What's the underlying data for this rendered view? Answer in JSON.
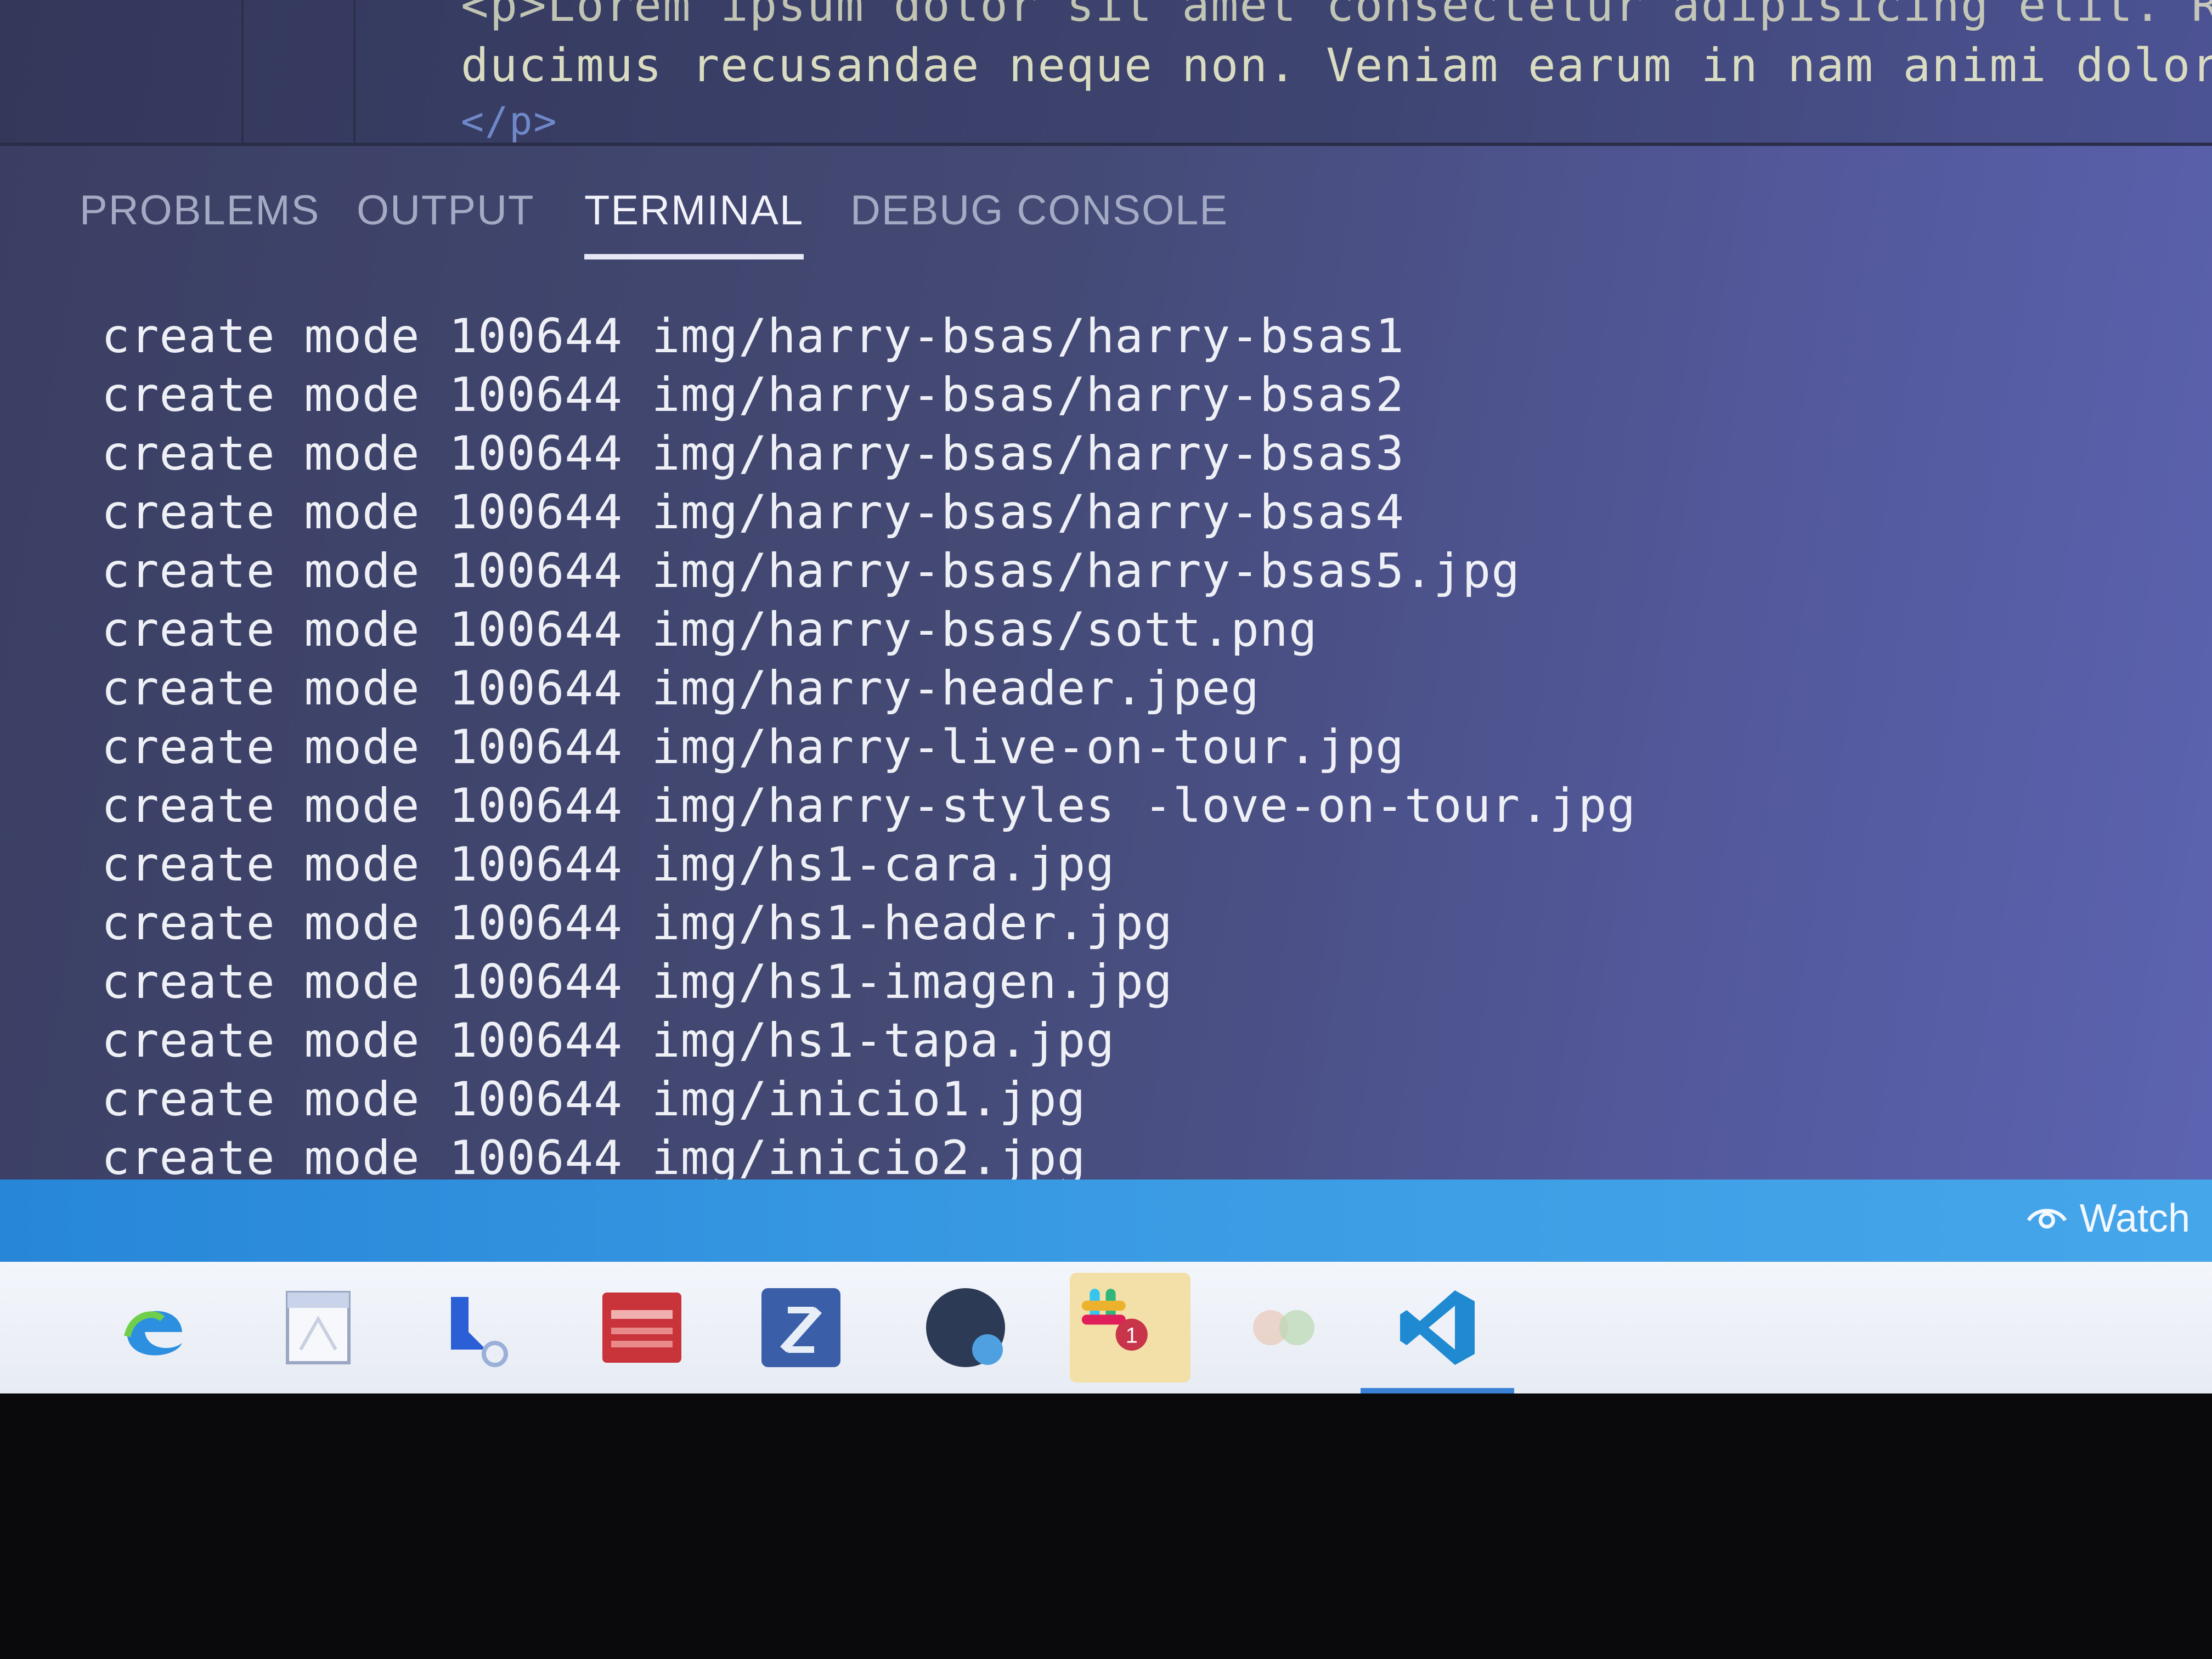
{
  "editor": {
    "lines": [
      "<p>Lorem ipsum dolor sit amet consectetur adipisicing elit. Repell",
      "ducimus recusandae neque non. Veniam earum in nam animi dolores la",
      "</p>"
    ]
  },
  "panel": {
    "tabs": [
      {
        "label": "PROBLEMS",
        "active": false
      },
      {
        "label": "OUTPUT",
        "active": false
      },
      {
        "label": "TERMINAL",
        "active": true
      },
      {
        "label": "DEBUG CONSOLE",
        "active": false
      }
    ]
  },
  "terminal": {
    "lines": [
      "create mode 100644 img/harry-bsas/harry-bsas1",
      "create mode 100644 img/harry-bsas/harry-bsas2",
      "create mode 100644 img/harry-bsas/harry-bsas3",
      "create mode 100644 img/harry-bsas/harry-bsas4",
      "create mode 100644 img/harry-bsas/harry-bsas5.jpg",
      "create mode 100644 img/harry-bsas/sott.png",
      "create mode 100644 img/harry-header.jpeg",
      "create mode 100644 img/harry-live-on-tour.jpg",
      "create mode 100644 img/harry-styles -love-on-tour.jpg",
      "create mode 100644 img/hs1-cara.jpg",
      "create mode 100644 img/hs1-header.jpg",
      "create mode 100644 img/hs1-imagen.jpg",
      "create mode 100644 img/hs1-tapa.jpg",
      "create mode 100644 img/inicio1.jpg",
      "create mode 100644 img/inicio2.jpg"
    ]
  },
  "statusbar": {
    "watch_label": "Watch",
    "watch_icon": "eye-icon"
  },
  "taskbar": {
    "items": [
      {
        "icon": "edge-icon"
      },
      {
        "icon": "document-icon"
      },
      {
        "icon": "app-icon"
      },
      {
        "icon": "app-icon"
      },
      {
        "icon": "app-icon"
      },
      {
        "icon": "app-icon"
      },
      {
        "icon": "slack-icon",
        "badge": "1"
      },
      {
        "icon": "app-icon"
      },
      {
        "icon": "vscode-icon"
      }
    ]
  },
  "colors": {
    "terminal_bg": "#444a75",
    "terminal_text": "#eef0f6",
    "statusbar": "#3a9be4",
    "taskbar": "#eef1f7"
  }
}
